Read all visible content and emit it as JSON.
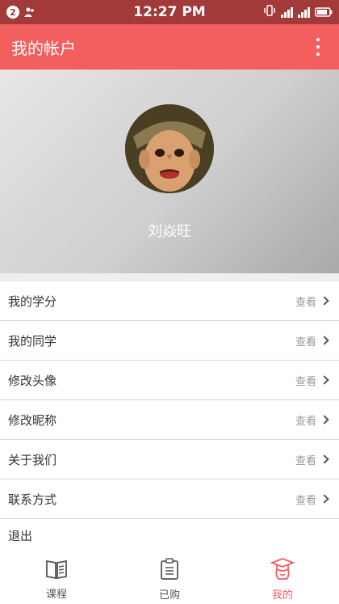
{
  "status_bar": {
    "notification_count": "2",
    "time": "12:27 PM"
  },
  "app_bar": {
    "title": "我的帐户"
  },
  "profile": {
    "name": "刘焱旺"
  },
  "menu": {
    "items": [
      {
        "label": "我的学分",
        "action": "查看"
      },
      {
        "label": "我的同学",
        "action": "查看"
      },
      {
        "label": "修改头像",
        "action": "查看"
      },
      {
        "label": "修改昵称",
        "action": "查看"
      },
      {
        "label": "关于我们",
        "action": "查看"
      },
      {
        "label": "联系方式",
        "action": "查看"
      }
    ],
    "logout_label": "退出"
  },
  "tab_bar": {
    "tabs": [
      {
        "label": "课程",
        "icon": "book-icon",
        "active": false
      },
      {
        "label": "已购",
        "icon": "clipboard-icon",
        "active": false
      },
      {
        "label": "我的",
        "icon": "graduate-icon",
        "active": true
      }
    ],
    "active_color": "#f35f5f"
  },
  "colors": {
    "status_bar": "#a23a3a",
    "app_bar": "#f35f5f"
  }
}
